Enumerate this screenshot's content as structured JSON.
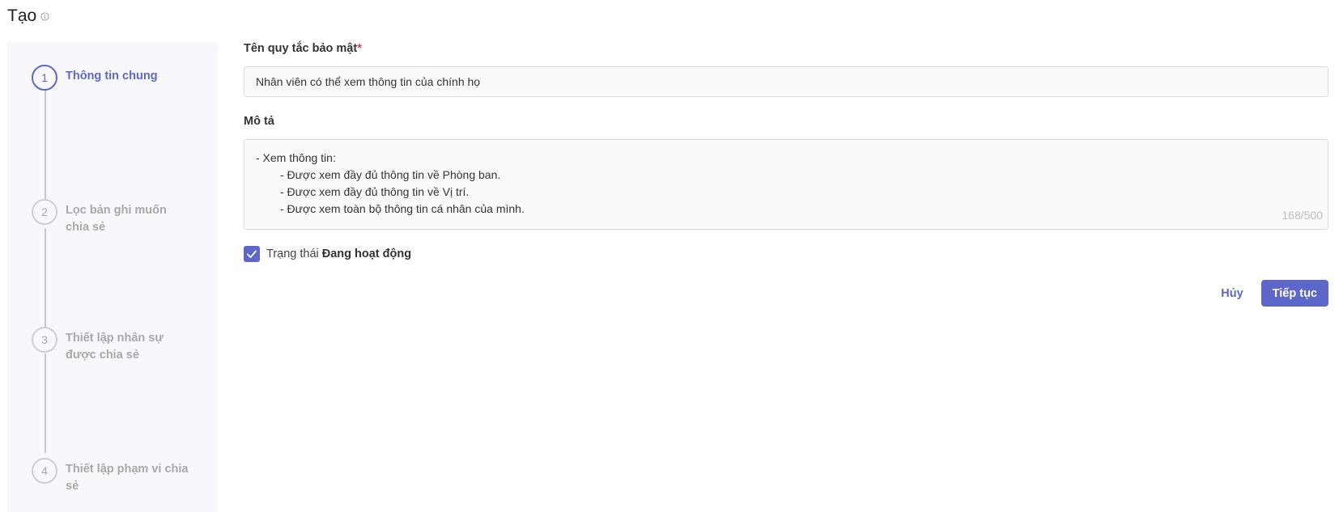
{
  "header": {
    "title": "Tạo"
  },
  "steps": [
    {
      "number": "1",
      "label": "Thông tin chung"
    },
    {
      "number": "2",
      "label": "Lọc bản ghi muốn chia sẻ"
    },
    {
      "number": "3",
      "label": "Thiết lập nhân sự được chia sẻ"
    },
    {
      "number": "4",
      "label": "Thiết lập phạm vi chia sẻ"
    }
  ],
  "form": {
    "name_label": "Tên quy tắc bảo mật",
    "required_mark": "*",
    "name_value": "Nhân viên có thể xem thông tin của chính họ",
    "description_label": "Mô tả",
    "description_lines": [
      "- Xem thông tin:",
      "- Được xem đầy đủ thông tin về Phòng ban.",
      "- Được xem đầy đủ thông tin về Vị trí.",
      "- Được xem toàn bộ thông tin cá nhân của mình."
    ],
    "char_count": "168/500",
    "status_prefix": "Trạng thái",
    "status_value": "Đang hoạt động",
    "status_checked": true
  },
  "actions": {
    "cancel_label": "Hủy",
    "continue_label": "Tiếp tục"
  },
  "colors": {
    "accent": "#5c67c9",
    "required": "#e0364a"
  }
}
